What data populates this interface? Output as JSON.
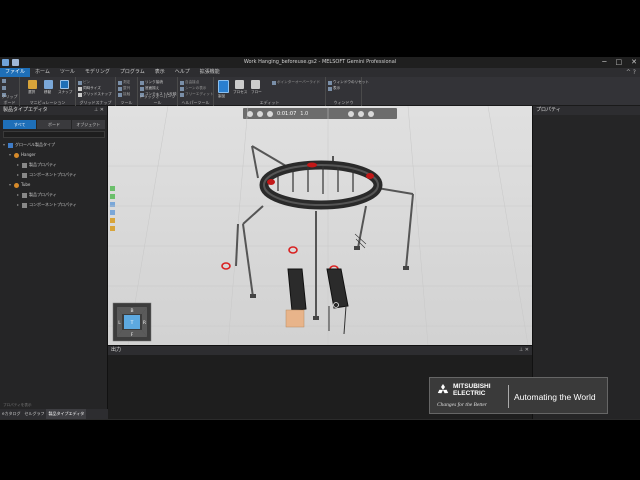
{
  "window": {
    "title": "Work Hanging_beforeuse.gs2 - MELSOFT Gemini Professional",
    "minimize_glyph": "─",
    "maximize_glyph": "□",
    "close_glyph": "✕"
  },
  "menu": {
    "items": [
      "ファイル",
      "ホーム",
      "ツール",
      "モデリング",
      "プログラム",
      "表示",
      "ヘルプ",
      "拡張機能"
    ],
    "active_index": 0,
    "right_glyph": "^ ?"
  },
  "ribbon": {
    "groups": [
      {
        "label": "クリップボード"
      },
      {
        "label": "マニピュレーション"
      },
      {
        "label": "グリッドスナップ"
      },
      {
        "label": "ツール"
      },
      {
        "label": "ドラッグオーバーツール"
      },
      {
        "label": "ヘルパーツール"
      },
      {
        "label": "エディット"
      },
      {
        "label": "ウィンドウ"
      }
    ],
    "buttons": {
      "select": "選択",
      "move": "移動",
      "snap": "スナップ",
      "object": "製品",
      "process": "プロセス",
      "flow": "フロー"
    },
    "options": {
      "pin": "ピン",
      "local": "ローカル",
      "same_size": "同時サイズ",
      "grid_snap": "グリッドスナップ",
      "measure": "測定",
      "align": "整列",
      "contact": "接触",
      "link_edit": "リンク接続",
      "bottom_align": "底面揃え",
      "free_contact": "自由接点",
      "context_menu": "コンテキスト&反映",
      "scene_display": "シーンの表示",
      "free_edit": "フリーエディット",
      "pointer_override": "ポインターオーバーライド",
      "window_reset": "ウィンドウのリセット",
      "window_display": "表示"
    }
  },
  "left_panel": {
    "title": "製品タイプエディタ",
    "tabs": [
      "すべて",
      "ボード",
      "オブジェクト"
    ],
    "active_tab": 0,
    "tree": [
      {
        "label": "グローバル製品タイプ",
        "level": 0,
        "icon": "folder-icon"
      },
      {
        "label": "Hanger",
        "level": 1,
        "icon": "product-icon"
      },
      {
        "label": "製品プロパティ",
        "level": 2,
        "icon": "property-icon"
      },
      {
        "label": "コンポーネントプロパティ",
        "level": 2,
        "icon": "property-icon"
      },
      {
        "label": "Tube",
        "level": 1,
        "icon": "product-icon"
      },
      {
        "label": "製品プロパティ",
        "level": 2,
        "icon": "property-icon"
      },
      {
        "label": "コンポーネントプロパティ",
        "level": 2,
        "icon": "property-icon"
      }
    ],
    "footer_note": "プロパティを表示",
    "bottom_tabs": [
      "eカタログ",
      "セルグラフ",
      "製品タイプエディタ"
    ],
    "active_bottom_tab": 2
  },
  "viewport": {
    "time": "0:01:07",
    "speed": "1.0",
    "nav_cube": {
      "top": "B",
      "left": "L",
      "center": "T",
      "right": "R",
      "bottom": "F"
    }
  },
  "right_panel": {
    "title": "プロパティ"
  },
  "output_panel": {
    "title": "出力"
  },
  "logo": {
    "brand_line1": "MITSUBISHI",
    "brand_line2": "ELECTRIC",
    "slogan": "Changes for the Better",
    "tagline": "Automating the World"
  },
  "colors": {
    "accent": "#1e6fb8",
    "panel_bg": "#252526",
    "viewport_bg": "#d8d8d8",
    "marker_red": "#d92020",
    "logo_red": "#e60012"
  }
}
